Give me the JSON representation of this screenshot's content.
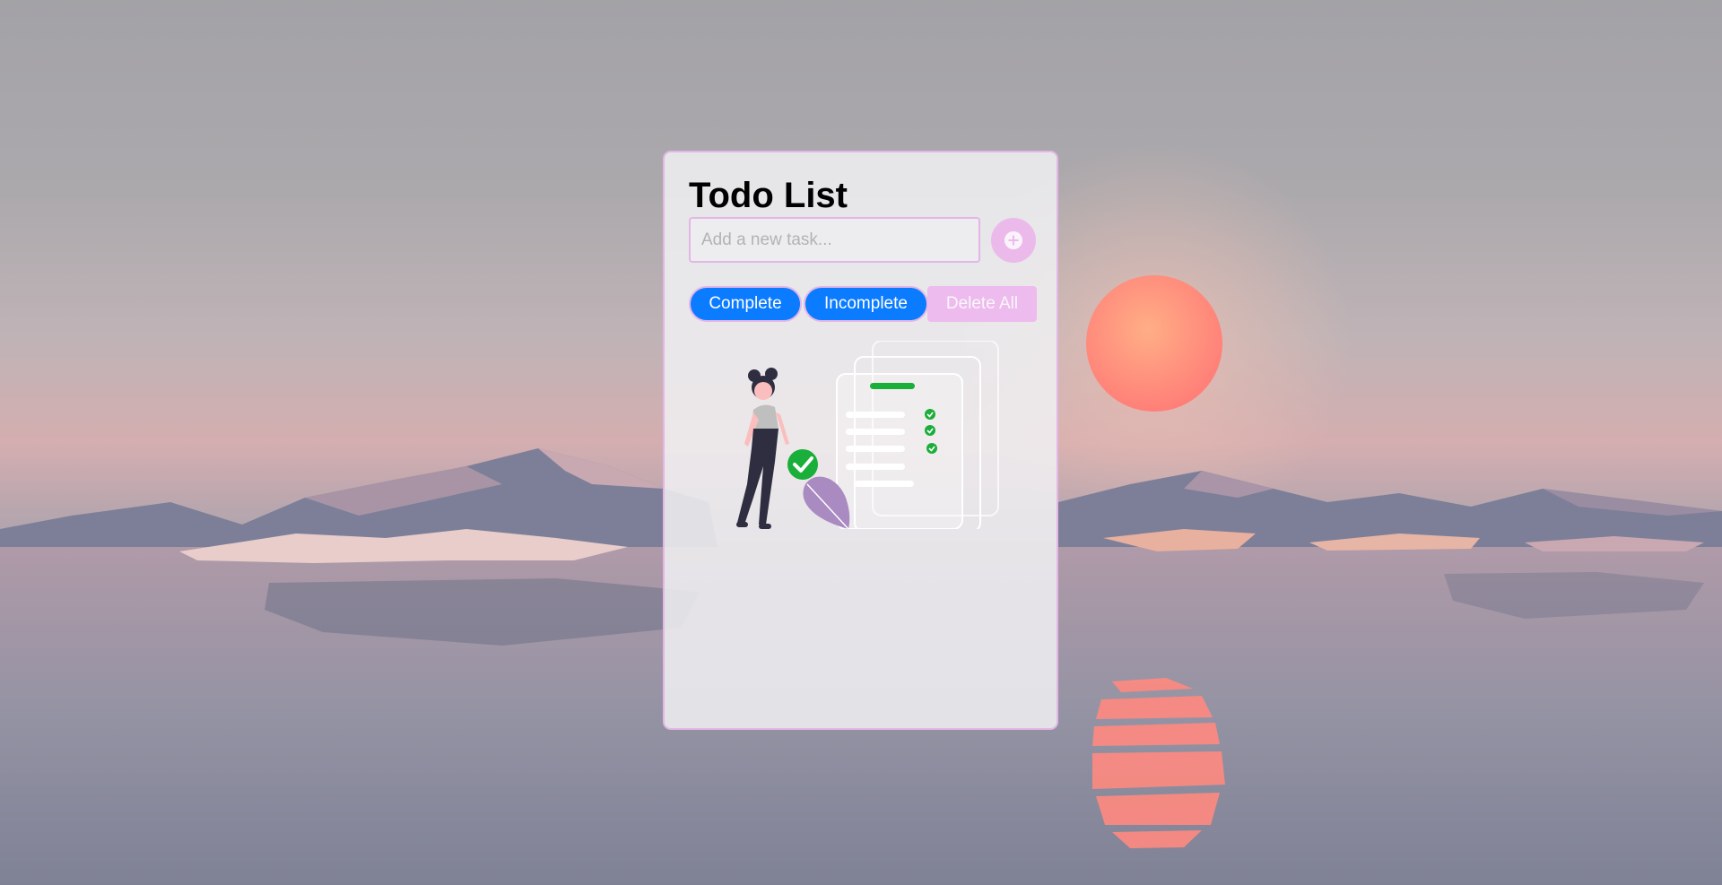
{
  "app": {
    "title": "Todo List"
  },
  "task_input": {
    "placeholder": "Add a new task...",
    "value": ""
  },
  "add_button": {
    "icon": "plus-circle-icon"
  },
  "filters": {
    "complete_label": "Complete",
    "incomplete_label": "Incomplete",
    "delete_all_label": "Delete All"
  },
  "empty_state": {
    "illustration": "woman-with-checklist-illustration"
  },
  "colors": {
    "accent_pink": "#e3b6e6",
    "button_blue": "#0b7bff",
    "check_green": "#1aae3a"
  }
}
